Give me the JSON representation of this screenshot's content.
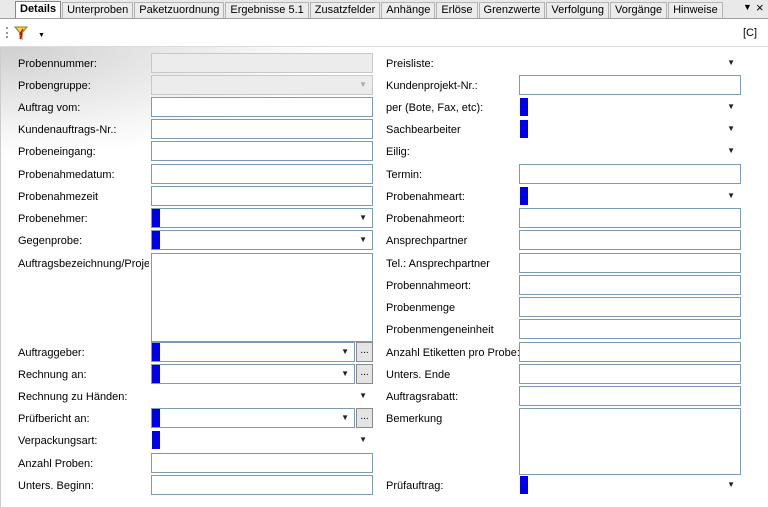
{
  "tabs": [
    "Details",
    "Unterproben",
    "Paketzuordnung",
    "Ergebnisse 5.1",
    "Zusatzfelder",
    "Anhänge",
    "Erlöse",
    "Grenzwerte",
    "Verfolgung",
    "Vorgänge",
    "Hinweise"
  ],
  "toolbar": {
    "right_label": "[C]",
    "icon": "filter-lightning-icon"
  },
  "window_controls": {
    "dropdown": "▼",
    "close": "×"
  },
  "left_fields": [
    {
      "label": "Probennummer:"
    },
    {
      "label": "Probengruppe:"
    },
    {
      "label": "Auftrag vom:"
    },
    {
      "label": "Kundenauftrags-Nr.:"
    },
    {
      "label": "Probeneingang:"
    },
    {
      "label": "Probenahmedatum:"
    },
    {
      "label": "Probenahmezeit"
    },
    {
      "label": "Probenehmer:"
    },
    {
      "label": "Gegenprobe:"
    },
    {
      "label": "Auftragsbezeichnung/Projekt:"
    },
    {
      "label": "Auftraggeber:"
    },
    {
      "label": "Rechnung an:"
    },
    {
      "label": "Rechnung zu Händen:"
    },
    {
      "label": "Prüfbericht an:"
    },
    {
      "label": "Verpackungsart:"
    },
    {
      "label": "Anzahl Proben:"
    },
    {
      "label": "Unters. Beginn:"
    }
  ],
  "right_fields": [
    {
      "label": "Preisliste:"
    },
    {
      "label": "Kundenprojekt-Nr.:"
    },
    {
      "label": "per (Bote, Fax, etc):"
    },
    {
      "label": "Sachbearbeiter"
    },
    {
      "label": "Eilig:"
    },
    {
      "label": "Termin:"
    },
    {
      "label": "Probenahmeart:"
    },
    {
      "label": "Probenahmeort:"
    },
    {
      "label": "Ansprechpartner"
    },
    {
      "label": "Tel.: Ansprechpartner"
    },
    {
      "label": "Probennahmeort:"
    },
    {
      "label": "Probenmenge"
    },
    {
      "label": "Probenmengeneinheit"
    },
    {
      "label": "Anzahl Etiketten pro Probe:"
    },
    {
      "label": "Unters. Ende"
    },
    {
      "label": "Auftragsrabatt:"
    },
    {
      "label": "Bemerkung"
    },
    {
      "label": "Prüfauftrag:"
    }
  ],
  "buttons": {
    "ellipsis": "..."
  },
  "colors": {
    "required_marker": "#0000e6",
    "field_border": "#7a9ab8"
  }
}
